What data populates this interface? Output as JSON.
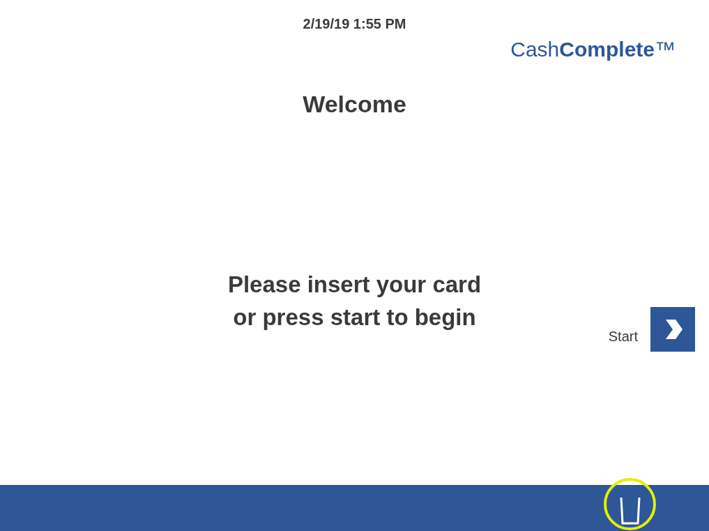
{
  "status": {
    "datetime": "2/19/19 1:55 PM"
  },
  "logo": {
    "text": "Cash**Complete**™"
  },
  "title": "Welcome",
  "message": {
    "lines": [
      "Please insert your card",
      "or press start to begin"
    ]
  },
  "start_button": {
    "label": "Start"
  },
  "bottom_bar": {
    "button": {
      "highlighted": true
    }
  }
}
